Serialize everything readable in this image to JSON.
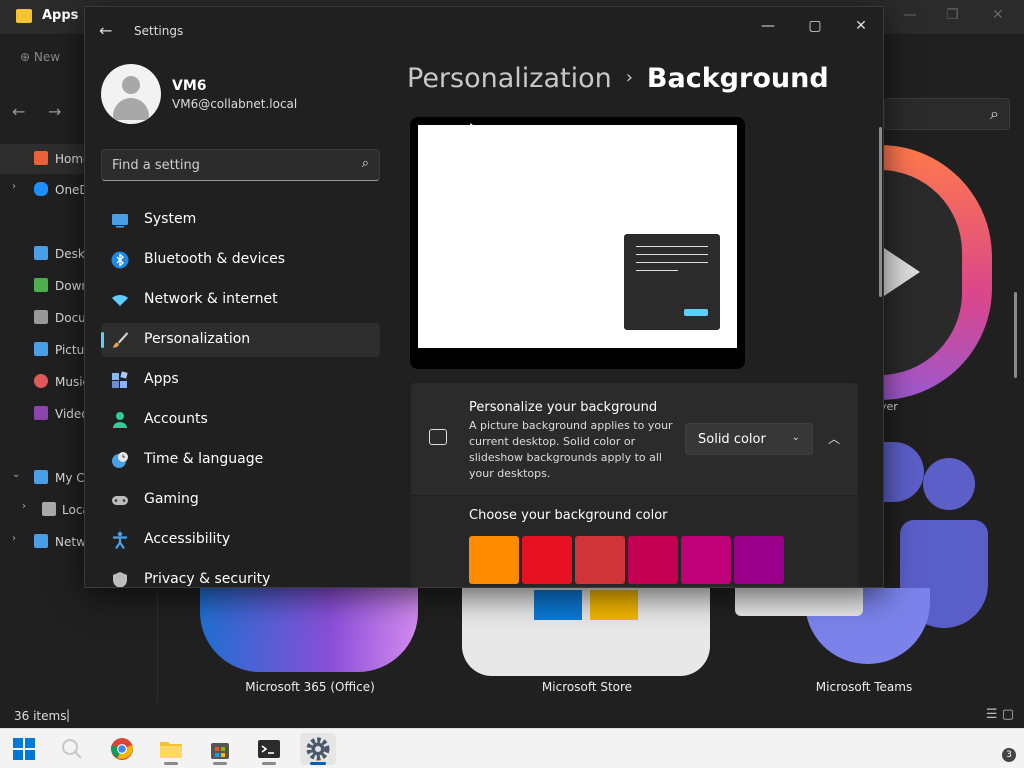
{
  "explorer": {
    "title": "Apps",
    "toolbar_new": "New",
    "sidebar": [
      {
        "label": "Home",
        "color": "#e8623a"
      },
      {
        "label": "OneDrive",
        "color": "#1e90ff"
      },
      {
        "label": "Desktop",
        "color": "#4aa0e6"
      },
      {
        "label": "Downloads",
        "color": "#4caf50"
      },
      {
        "label": "Documents",
        "color": "#9a9a9a"
      },
      {
        "label": "Pictures",
        "color": "#4aa0e6"
      },
      {
        "label": "Music",
        "color": "#e05a5a"
      },
      {
        "label": "Videos",
        "color": "#8e44ad"
      },
      {
        "label": "My Computer",
        "color": "#4aa0e6"
      },
      {
        "label": "Local",
        "color": "#aaaaaa"
      },
      {
        "label": "Network",
        "color": "#4aa0e6"
      }
    ],
    "tiles": [
      {
        "label": "Microsoft 365 (Office)"
      },
      {
        "label": "Microsoft Store"
      },
      {
        "label": "Microsoft Teams"
      }
    ],
    "tile_partial_label": "yer",
    "status_count": "36 items"
  },
  "settings": {
    "title": "Settings",
    "user": {
      "name": "VM6",
      "email": "VM6@collabnet.local"
    },
    "search_placeholder": "Find a setting",
    "nav": [
      {
        "label": "System",
        "icon": "monitor-icon",
        "color": "#4aa0e6"
      },
      {
        "label": "Bluetooth & devices",
        "icon": "bluetooth-icon",
        "color": "#1e88e5"
      },
      {
        "label": "Network & internet",
        "icon": "wifi-icon",
        "color": "#60cdff"
      },
      {
        "label": "Personalization",
        "icon": "brush-icon",
        "color": "#e0a060",
        "active": true
      },
      {
        "label": "Apps",
        "icon": "apps-icon",
        "color": "#8ab4f8"
      },
      {
        "label": "Accounts",
        "icon": "person-icon",
        "color": "#2ecc9a"
      },
      {
        "label": "Time & language",
        "icon": "clock-globe-icon",
        "color": "#4aa0e6"
      },
      {
        "label": "Gaming",
        "icon": "gamepad-icon",
        "color": "#bdbdbd"
      },
      {
        "label": "Accessibility",
        "icon": "accessibility-icon",
        "color": "#4aa0e6"
      },
      {
        "label": "Privacy & security",
        "icon": "shield-icon",
        "color": "#bdbdbd"
      }
    ],
    "breadcrumb": {
      "parent": "Personalization",
      "separator": "›",
      "current": "Background"
    },
    "bg_card": {
      "title": "Personalize your background",
      "description": "A picture background applies to your current desktop. Solid color or slideshow backgrounds apply to all your desktops.",
      "selected": "Solid color"
    },
    "color_card": {
      "title": "Choose your background color",
      "swatches_row1": [
        "#ff8c00",
        "#e81123",
        "#d13438",
        "#c30052",
        "#bf0077",
        "#9a0089"
      ],
      "swatches_row2": [
        "#b4009e",
        "#744da9",
        "#107c10",
        "#10893e",
        "#00b294",
        "#038387"
      ]
    },
    "accent": "#60cdff"
  },
  "taskbar": {
    "notification_count": "3",
    "items": [
      {
        "name": "start-button"
      },
      {
        "name": "search-button"
      },
      {
        "name": "chrome-app"
      },
      {
        "name": "file-explorer-app"
      },
      {
        "name": "microsoft-store-app"
      },
      {
        "name": "terminal-app"
      },
      {
        "name": "settings-app"
      }
    ]
  }
}
